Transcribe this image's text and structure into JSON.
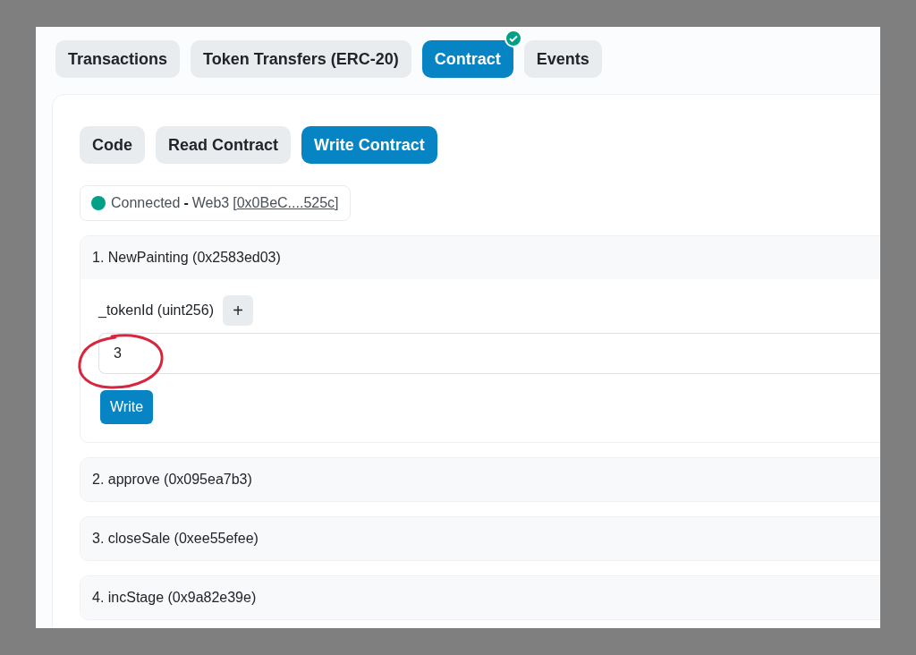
{
  "tabs": [
    {
      "label": "Transactions",
      "selected": false,
      "verified": false
    },
    {
      "label": "Token Transfers (ERC-20)",
      "selected": false,
      "verified": false
    },
    {
      "label": "Contract",
      "selected": true,
      "verified": true
    },
    {
      "label": "Events",
      "selected": false,
      "verified": false
    }
  ],
  "subtabs": [
    {
      "label": "Code",
      "selected": false
    },
    {
      "label": "Read Contract",
      "selected": false
    },
    {
      "label": "Write Contract",
      "selected": true
    }
  ],
  "connection": {
    "connected": true,
    "status": "Connected",
    "separator": "-",
    "provider": "Web3",
    "bracket_open": "[",
    "address": "0x0BeC....525c",
    "bracket_close": "]"
  },
  "methods": [
    {
      "title": "1. NewPainting (0x2583ed03)",
      "expanded": true,
      "inputs": [
        {
          "label": "_tokenId (uint256)",
          "add": "+",
          "value": "3",
          "circled": true
        }
      ],
      "action": "Write"
    },
    {
      "title": "2. approve (0x095ea7b3)",
      "expanded": false
    },
    {
      "title": "3. closeSale (0xee55efee)",
      "expanded": false
    },
    {
      "title": "4. incStage (0x9a82e39e)",
      "expanded": false
    }
  ]
}
